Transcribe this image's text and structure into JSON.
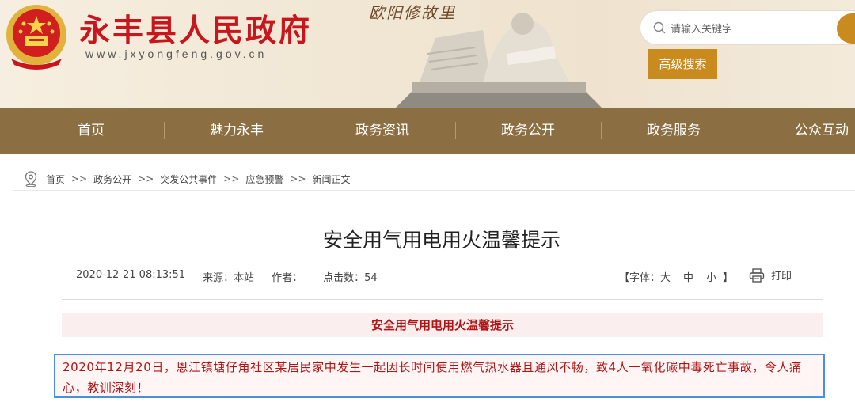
{
  "header": {
    "site_title": "永丰县人民政府",
    "site_url": "www.jxyongfeng.gov.cn",
    "banner_text": "欧阳修故里",
    "search": {
      "placeholder": "请输入关键字"
    },
    "advanced_search_label": "高级搜索"
  },
  "nav": {
    "items": [
      {
        "label": "首页"
      },
      {
        "label": "魅力永丰"
      },
      {
        "label": "政务资讯"
      },
      {
        "label": "政务公开"
      },
      {
        "label": "政务服务"
      },
      {
        "label": "公众互动"
      }
    ]
  },
  "breadcrumb": {
    "items": [
      "首页",
      "政务公开",
      "突发公共事件",
      "应急预警",
      "新闻正文"
    ],
    "separator": ">>"
  },
  "article": {
    "title": "安全用气用电用火温馨提示",
    "date": "2020-12-21 08:13:51",
    "source": "来源：本站",
    "author": "作者：",
    "views": "点击数：54",
    "font_size": {
      "prefix": "【字体：",
      "large": "大",
      "medium": "中",
      "small": "小",
      "suffix": "】"
    },
    "print_label": "打印",
    "subtitle": "安全用气用电用火温馨提示",
    "paragraph": "2020年12月20日，恩江镇塘仔角社区某居民家中发生一起因长时间使用燃气热水器且通风不畅，致4人一氧化碳中毒死亡事故，令人痛心，教训深刻！"
  },
  "colors": {
    "brand_red": "#c8161d",
    "nav_brown": "#8b6f42",
    "accent_orange": "#c98a1e",
    "highlight_border": "#4a90e2"
  }
}
